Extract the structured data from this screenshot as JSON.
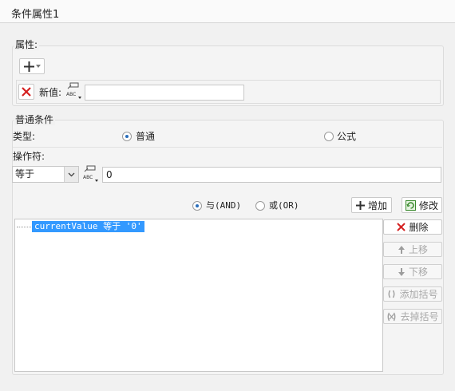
{
  "window": {
    "title": "条件属性1"
  },
  "attributes": {
    "group_label": "属性:",
    "new_value_label": "新值:",
    "new_value": ""
  },
  "conditions": {
    "group_label": "普通条件",
    "type_label": "类型:",
    "type_options": [
      {
        "label": "普通",
        "selected": true
      },
      {
        "label": "公式",
        "selected": false
      }
    ],
    "operator_label": "操作符:",
    "operator_value": "等于",
    "operand_value": "0",
    "logic_options": [
      {
        "label": "与(AND)",
        "selected": true
      },
      {
        "label": "或(OR)",
        "selected": false
      }
    ],
    "add_button": "增加",
    "modify_button": "修改",
    "condition_list": [
      "currentValue 等于 '0'"
    ],
    "delete_button": "删除",
    "move_up_button": "上移",
    "move_down_button": "下移",
    "add_bracket_button": "添加括号",
    "remove_bracket_button": "去掉括号"
  },
  "colors": {
    "selection": "#3399ff",
    "delete_red": "#d42020",
    "radio_dot": "#2a6ebb"
  }
}
